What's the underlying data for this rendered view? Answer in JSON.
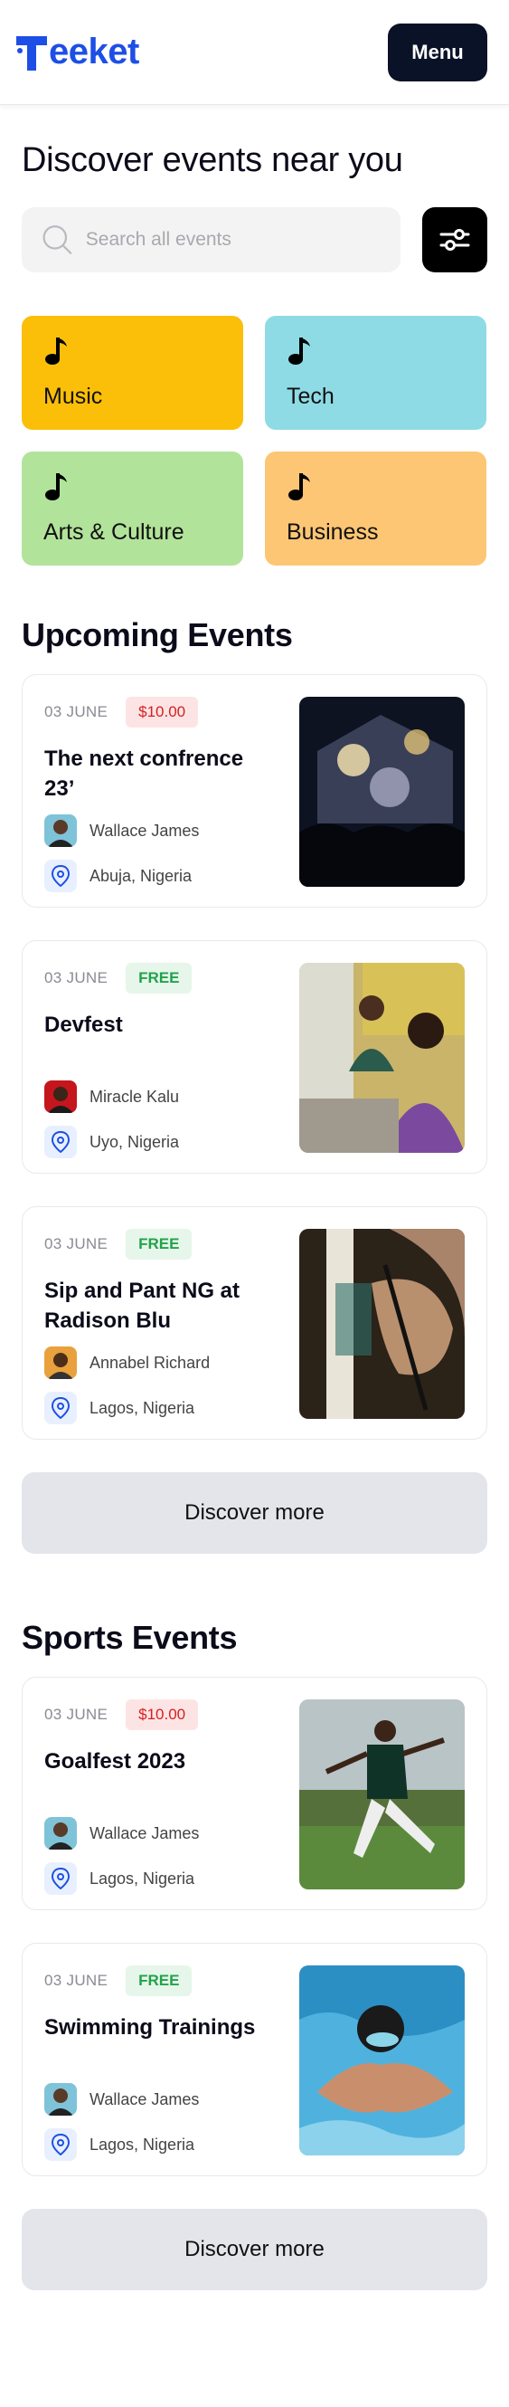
{
  "header": {
    "logo_text": "eeket",
    "menu_label": "Menu"
  },
  "hero": {
    "title": "Discover events near you"
  },
  "search": {
    "placeholder": "Search all events"
  },
  "categories": [
    {
      "label": "Music",
      "color": "#fbbf0a"
    },
    {
      "label": "Tech",
      "color": "#8edbe5"
    },
    {
      "label": "Arts & Culture",
      "color": "#b2e39a"
    },
    {
      "label": "Business",
      "color": "#fcc674"
    }
  ],
  "upcoming": {
    "title": "Upcoming Events",
    "events": [
      {
        "date": "03 JUNE",
        "price": "$10.00",
        "title": "The next confrence 23’",
        "organizer": "Wallace James",
        "location": "Abuja, Nigeria"
      },
      {
        "date": "03 JUNE",
        "price": "FREE",
        "title": "Devfest",
        "organizer": "Miracle Kalu",
        "location": "Uyo, Nigeria"
      },
      {
        "date": "03 JUNE",
        "price": "FREE",
        "title": "Sip and Pant NG at Radison Blu",
        "organizer": "Annabel Richard",
        "location": "Lagos, Nigeria"
      }
    ],
    "discover_label": "Discover more"
  },
  "sports": {
    "title": "Sports Events",
    "events": [
      {
        "date": "03 JUNE",
        "price": "$10.00",
        "title": "Goalfest 2023",
        "organizer": "Wallace James",
        "location": "Lagos, Nigeria"
      },
      {
        "date": "03 JUNE",
        "price": "FREE",
        "title": "Swimming Trainings",
        "organizer": "Wallace James",
        "location": "Lagos, Nigeria"
      }
    ],
    "discover_label": "Discover more"
  },
  "colors": {
    "brand": "#1d4fe6",
    "menu_bg": "#0a1228",
    "paid": "#d42020",
    "free": "#22a24a"
  }
}
